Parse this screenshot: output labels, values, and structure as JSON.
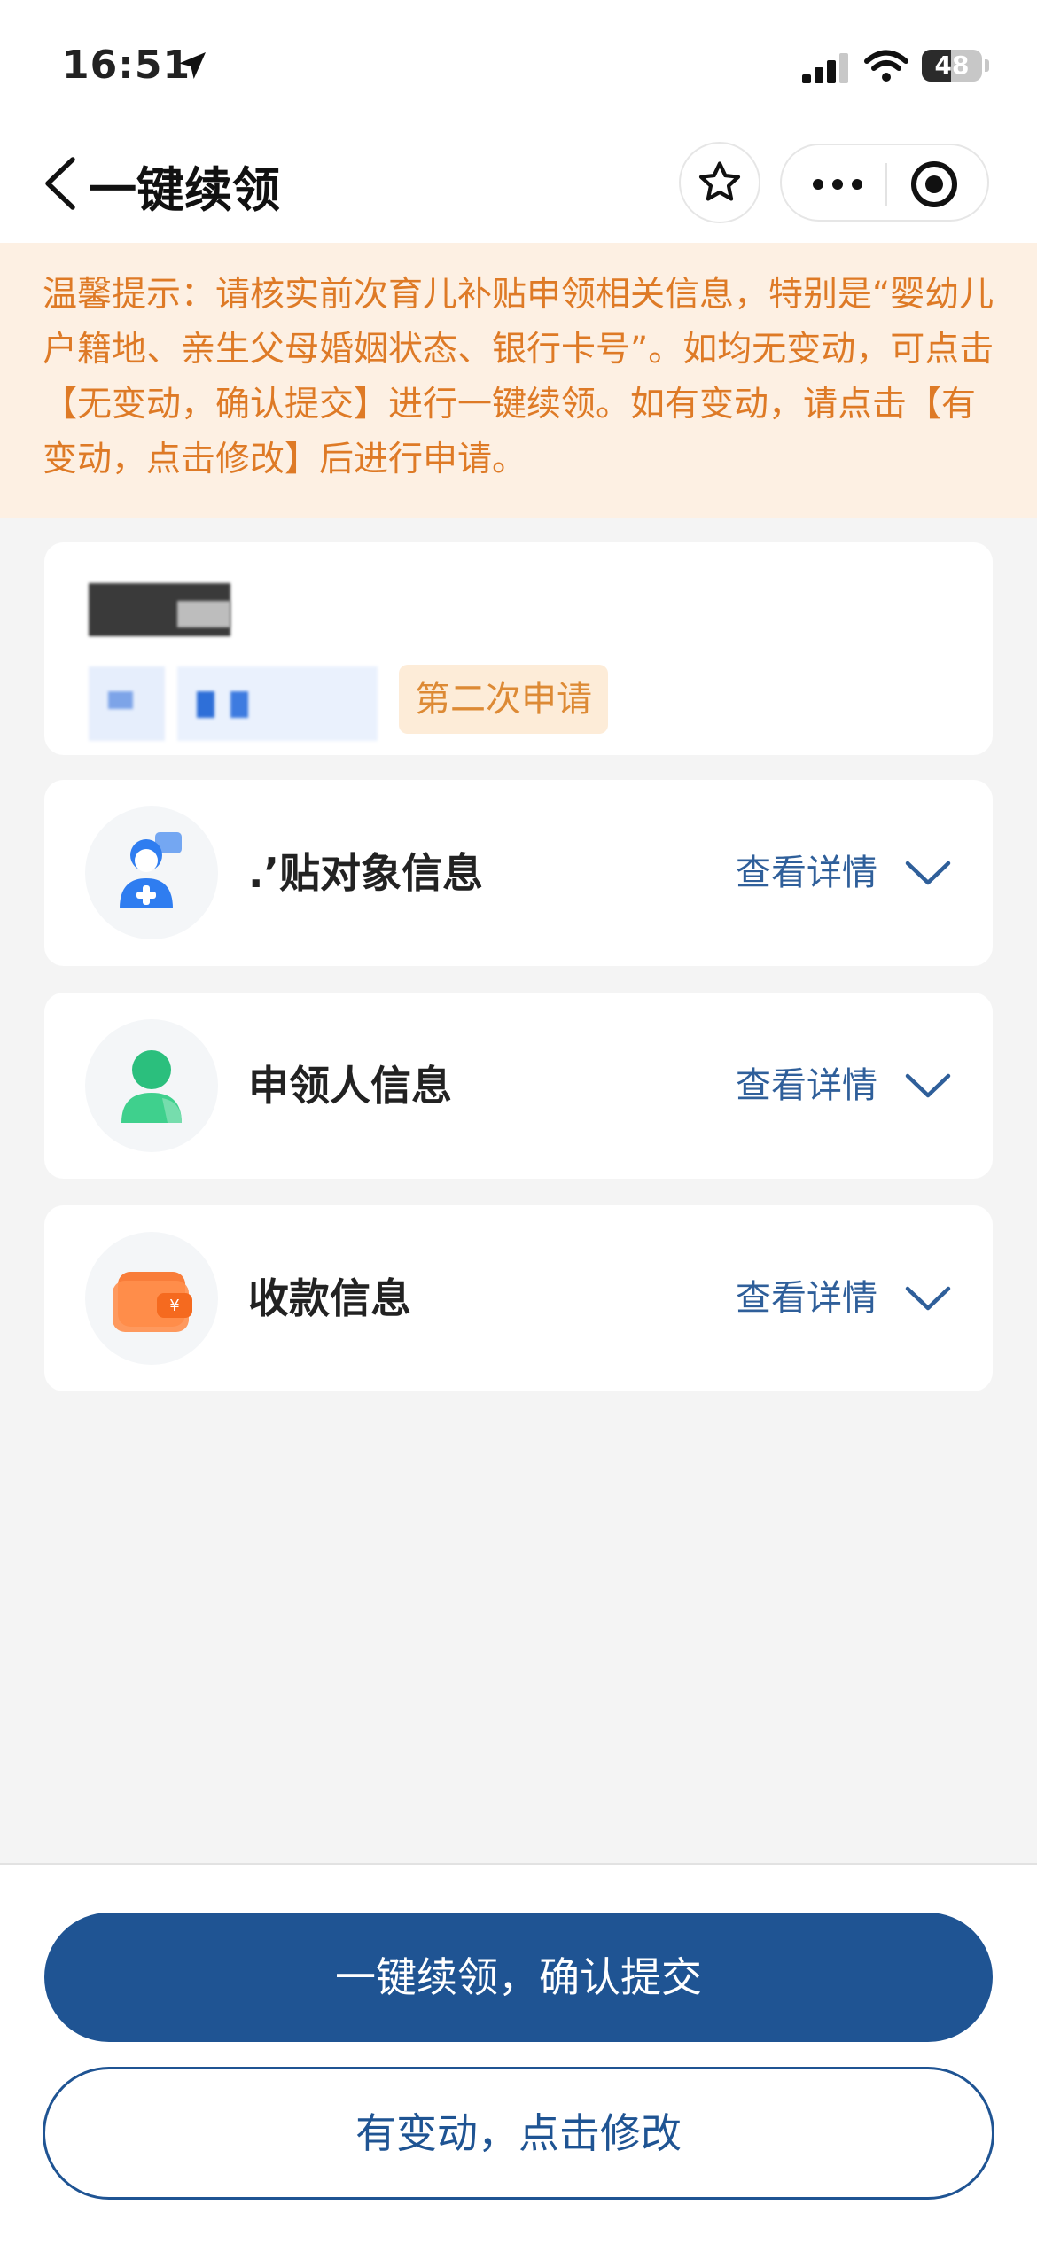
{
  "status_bar": {
    "time": "16:51",
    "battery": 48,
    "battery_label": "48",
    "icons": [
      "location-arrow-icon",
      "cellular-signal-icon",
      "wifi-icon",
      "battery-icon"
    ]
  },
  "nav": {
    "title": "一键续领",
    "icons": [
      "back-chevron-icon",
      "star-icon",
      "more-dots-icon",
      "target-icon"
    ]
  },
  "notice": {
    "text": "温馨提示：请核实前次育儿补贴申领相关信息，特别是“婴幼儿户籍地、亲生父母婚姻状态、银行卡号”。如均无变动，可点击【无变动，确认提交】进行一键续领。如有变动，请点击【有变动，点击修改】后进行申请。"
  },
  "applicant_card": {
    "tag": "第二次申请"
  },
  "sections": [
    {
      "label": ".ʼ贴对象信息",
      "detail": "查看详情",
      "icon": "child-avatar-icon"
    },
    {
      "label": "申领人信息",
      "detail": "查看详情",
      "icon": "person-icon"
    },
    {
      "label": "收款信息",
      "detail": "查看详情",
      "icon": "wallet-icon"
    }
  ],
  "actions": {
    "confirm": "一键续领，确认提交",
    "modify": "有变动，点击修改"
  },
  "colors": {
    "primary": "#1f5493",
    "notice_bg": "#fdf0e3",
    "notice_text": "#de7a26",
    "link": "#2f5f9a",
    "page_bg": "#f4f4f4"
  }
}
